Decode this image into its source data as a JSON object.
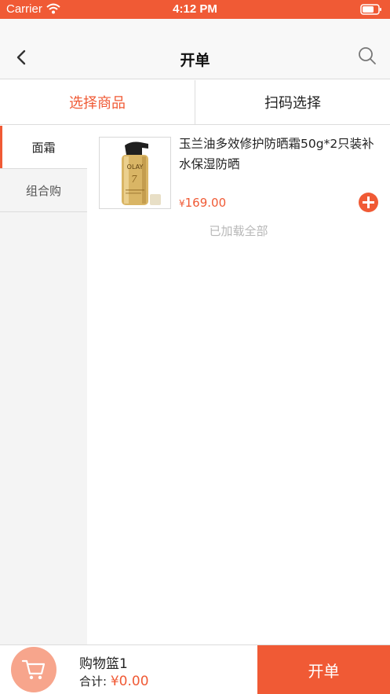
{
  "status_bar": {
    "carrier": "Carrier",
    "time": "4:12 PM",
    "icons": [
      "wifi-icon",
      "battery-icon"
    ]
  },
  "nav": {
    "title": "开单",
    "back_icon": "chevron-left-icon",
    "search_icon": "search-icon"
  },
  "tabs": [
    {
      "label": "选择商品",
      "active": true
    },
    {
      "label": "扫码选择",
      "active": false
    }
  ],
  "categories": [
    {
      "label": "面霜",
      "active": true
    },
    {
      "label": "组合购",
      "active": false
    }
  ],
  "products": [
    {
      "name": "玉兰油多效修护防晒霜50g*2只装补水保湿防晒",
      "price_symbol": "¥",
      "price": "169.00",
      "image_label": "OLAY"
    }
  ],
  "list_footer": "已加载全部",
  "cart": {
    "title": "购物篮1",
    "total_label": "合计:",
    "total_value": "¥0.00",
    "icon": "cart-icon"
  },
  "checkout_label": "开单",
  "colors": {
    "accent": "#f05a35",
    "cart_badge": "#f7a58c",
    "sidebar_bg": "#f4f4f4",
    "muted_text": "#b7b7b7"
  }
}
